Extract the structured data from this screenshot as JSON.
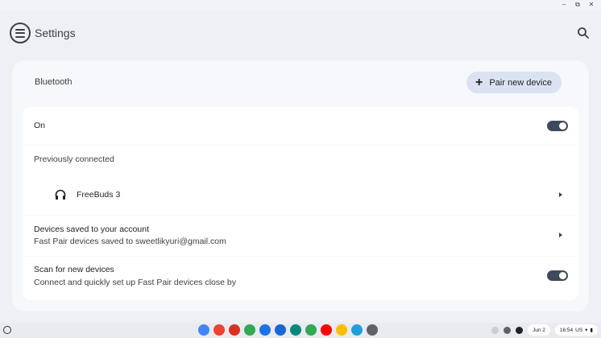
{
  "window": {
    "controls": [
      "–",
      "⧉",
      "✕"
    ]
  },
  "header": {
    "title": "Settings",
    "menu_icon": "hamburger-menu-icon",
    "search_icon": "search-icon"
  },
  "bluetooth": {
    "title": "Bluetooth",
    "pair_button": "Pair new device",
    "on_label": "On",
    "on_state": true,
    "previously_connected": "Previously connected",
    "device": {
      "name": "FreeBuds 3",
      "icon": "headphones-icon"
    },
    "saved": {
      "title": "Devices saved to your account",
      "subtitle": "Fast Pair devices saved to sweetlikyuri@gmail.com"
    },
    "scan": {
      "title": "Scan for new devices",
      "subtitle": "Connect and quickly set up Fast Pair devices close by",
      "state": true
    }
  },
  "taskbar": {
    "apps": [
      {
        "name": "assistant",
        "color": "#4285f4"
      },
      {
        "name": "chrome",
        "color": "#ea4335"
      },
      {
        "name": "gmail",
        "color": "#d93025"
      },
      {
        "name": "docs",
        "color": "#34a853"
      },
      {
        "name": "files",
        "color": "#1a73e8"
      },
      {
        "name": "messages",
        "color": "#1967d2"
      },
      {
        "name": "meet",
        "color": "#00897b"
      },
      {
        "name": "play-store",
        "color": "#34a853"
      },
      {
        "name": "youtube",
        "color": "#ff0000"
      },
      {
        "name": "photos",
        "color": "#fbbc04"
      },
      {
        "name": "telegram",
        "color": "#229ed9"
      },
      {
        "name": "settings",
        "color": "#5f6368"
      }
    ],
    "date": "Jun 2",
    "time": "16:54",
    "region": "US"
  }
}
